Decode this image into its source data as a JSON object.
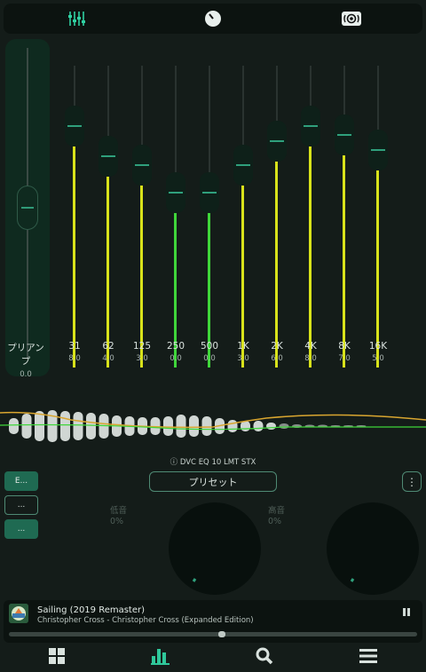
{
  "topbar": {
    "icons": [
      "equalizer-sliders-icon",
      "dial-icon",
      "surround-speaker-icon"
    ]
  },
  "preamp": {
    "label": "プリアンプ",
    "value": "0.0"
  },
  "bands": [
    {
      "freq": "31",
      "gain": "8.0",
      "level": 0.8
    },
    {
      "freq": "62",
      "gain": "4.0",
      "level": 0.7
    },
    {
      "freq": "125",
      "gain": "3.0",
      "level": 0.67
    },
    {
      "freq": "250",
      "gain": "0.0",
      "level": 0.58
    },
    {
      "freq": "500",
      "gain": "0.0",
      "level": 0.58
    },
    {
      "freq": "1K",
      "gain": "3.0",
      "level": 0.67
    },
    {
      "freq": "2K",
      "gain": "6.0",
      "level": 0.75
    },
    {
      "freq": "4K",
      "gain": "8.0",
      "level": 0.8
    },
    {
      "freq": "8K",
      "gain": "7.0",
      "level": 0.77
    },
    {
      "freq": "16K",
      "gain": "5.0",
      "level": 0.72
    }
  ],
  "dvc_label": "ⓘ DVC EQ 10 LMT STX",
  "side_buttons": [
    "E...",
    "...",
    "..."
  ],
  "preset_label": "プリセット",
  "more_label": "⋮",
  "bass": {
    "label": "低音",
    "value": "0%"
  },
  "treble": {
    "label": "高音",
    "value": "0%"
  },
  "player": {
    "title": "Sailing (2019 Remaster)",
    "subtitle": "Christopher Cross - Christopher Cross (Expanded Edition)",
    "progress": 0.5
  },
  "bottom_nav": [
    "grid-icon",
    "bar-chart-icon",
    "search-icon",
    "menu-icon"
  ],
  "colors": {
    "accent": "#2fa07c",
    "eq_fill_yellow": "#d8e21a",
    "eq_fill_green": "#3fd63a",
    "curve_orange": "#d9a630"
  }
}
